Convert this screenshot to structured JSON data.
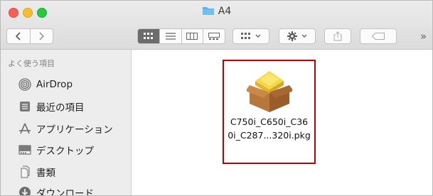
{
  "window": {
    "title": "A4"
  },
  "sidebar": {
    "heading": "よく使う項目",
    "items": [
      {
        "label": "AirDrop",
        "icon": "airdrop-icon"
      },
      {
        "label": "最近の項目",
        "icon": "recents-icon"
      },
      {
        "label": "アプリケーション",
        "icon": "applications-icon"
      },
      {
        "label": "デスクトップ",
        "icon": "desktop-icon"
      },
      {
        "label": "書類",
        "icon": "documents-icon"
      },
      {
        "label": "ダウンロード",
        "icon": "downloads-icon"
      }
    ]
  },
  "file": {
    "name_line1": "C750i_C650i_C36",
    "name_line2": "0i_C287...320i.pkg",
    "icon": "package-icon"
  },
  "toolbar": {
    "more": "»"
  },
  "colors": {
    "selection_border": "#c00000",
    "folder_blue": "#5ab2e8"
  }
}
